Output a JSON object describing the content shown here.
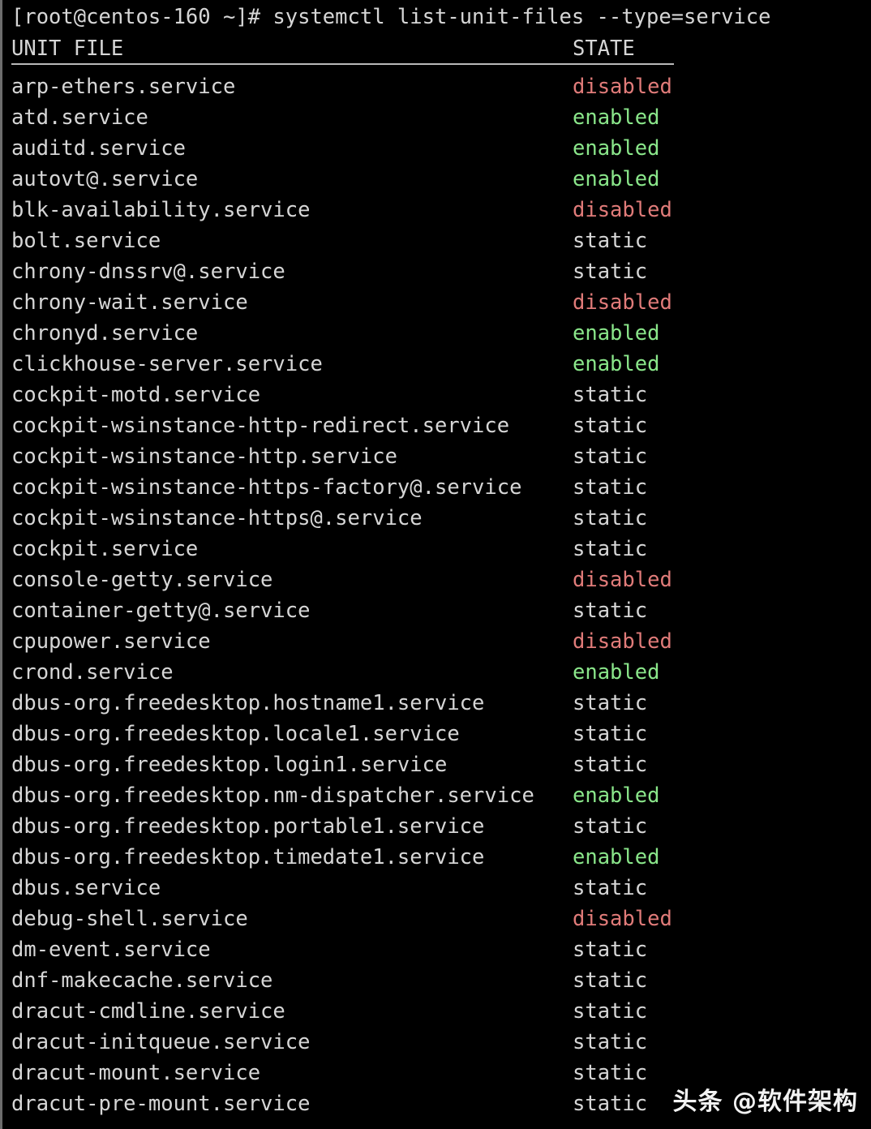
{
  "terminal": {
    "prompt": "[root@centos-160 ~]# systemctl list-unit-files --type=service",
    "prompt_user": "root",
    "prompt_host": "centos-160",
    "prompt_cwd": "~",
    "prompt_symbol": "#",
    "command": "systemctl list-unit-files --type=service",
    "colors": {
      "background": "#000000",
      "foreground": "#d6d6d6",
      "enabled": "#8ae68a",
      "disabled": "#e07b79",
      "static": "#d6d6d6",
      "rule": "#b9b9b9"
    }
  },
  "table": {
    "headers": {
      "unit_file": "UNIT FILE",
      "state": "STATE"
    },
    "rows": [
      {
        "unit": "arp-ethers.service",
        "state": "disabled"
      },
      {
        "unit": "atd.service",
        "state": "enabled"
      },
      {
        "unit": "auditd.service",
        "state": "enabled"
      },
      {
        "unit": "autovt@.service",
        "state": "enabled"
      },
      {
        "unit": "blk-availability.service",
        "state": "disabled"
      },
      {
        "unit": "bolt.service",
        "state": "static"
      },
      {
        "unit": "chrony-dnssrv@.service",
        "state": "static"
      },
      {
        "unit": "chrony-wait.service",
        "state": "disabled"
      },
      {
        "unit": "chronyd.service",
        "state": "enabled"
      },
      {
        "unit": "clickhouse-server.service",
        "state": "enabled"
      },
      {
        "unit": "cockpit-motd.service",
        "state": "static"
      },
      {
        "unit": "cockpit-wsinstance-http-redirect.service",
        "state": "static"
      },
      {
        "unit": "cockpit-wsinstance-http.service",
        "state": "static"
      },
      {
        "unit": "cockpit-wsinstance-https-factory@.service",
        "state": "static"
      },
      {
        "unit": "cockpit-wsinstance-https@.service",
        "state": "static"
      },
      {
        "unit": "cockpit.service",
        "state": "static"
      },
      {
        "unit": "console-getty.service",
        "state": "disabled"
      },
      {
        "unit": "container-getty@.service",
        "state": "static"
      },
      {
        "unit": "cpupower.service",
        "state": "disabled"
      },
      {
        "unit": "crond.service",
        "state": "enabled"
      },
      {
        "unit": "dbus-org.freedesktop.hostname1.service",
        "state": "static"
      },
      {
        "unit": "dbus-org.freedesktop.locale1.service",
        "state": "static"
      },
      {
        "unit": "dbus-org.freedesktop.login1.service",
        "state": "static"
      },
      {
        "unit": "dbus-org.freedesktop.nm-dispatcher.service",
        "state": "enabled"
      },
      {
        "unit": "dbus-org.freedesktop.portable1.service",
        "state": "static"
      },
      {
        "unit": "dbus-org.freedesktop.timedate1.service",
        "state": "enabled"
      },
      {
        "unit": "dbus.service",
        "state": "static"
      },
      {
        "unit": "debug-shell.service",
        "state": "disabled"
      },
      {
        "unit": "dm-event.service",
        "state": "static"
      },
      {
        "unit": "dnf-makecache.service",
        "state": "static"
      },
      {
        "unit": "dracut-cmdline.service",
        "state": "static"
      },
      {
        "unit": "dracut-initqueue.service",
        "state": "static"
      },
      {
        "unit": "dracut-mount.service",
        "state": "static"
      },
      {
        "unit": "dracut-pre-mount.service",
        "state": "static"
      }
    ]
  },
  "watermark": {
    "text": "头条 @软件架构"
  }
}
